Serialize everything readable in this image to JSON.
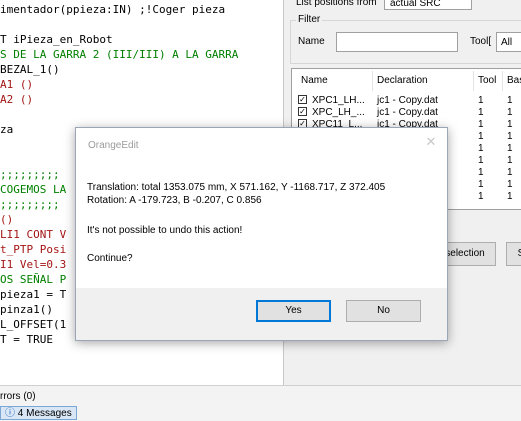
{
  "editor": {
    "lines": [
      {
        "text": "imentador(ppieza:IN) ;!Coger pieza",
        "tone": "blk"
      },
      {
        "text": "",
        "tone": "blk"
      },
      {
        "text": "T iPieza_en_Robot",
        "tone": "blk"
      },
      {
        "text": "S DE LA GARRA 2 (III/III) A LA GARRA",
        "tone": "grn"
      },
      {
        "text": "BEZAL_1()",
        "tone": "blk"
      },
      {
        "text": "A1 ()",
        "tone": "red"
      },
      {
        "text": "A2 ()",
        "tone": "red"
      },
      {
        "text": "",
        "tone": "blk"
      },
      {
        "text": "za",
        "tone": "blk"
      },
      {
        "text": "",
        "tone": "blk"
      },
      {
        "text": "",
        "tone": "blk"
      },
      {
        "text": ";;;;;;;;;",
        "tone": "grn"
      },
      {
        "text": "COGEMOS LA",
        "tone": "grn"
      },
      {
        "text": ";;;;;;;;;",
        "tone": "grn"
      },
      {
        "text": "()",
        "tone": "red"
      },
      {
        "text": "LI1 CONT V",
        "tone": "red"
      },
      {
        "text": "t_PTP Posi",
        "tone": "red"
      },
      {
        "text": "I1 Vel=0.3",
        "tone": "red"
      },
      {
        "text": "OS SEÑAL P",
        "tone": "grn"
      },
      {
        "text": "pieza1 = T",
        "tone": "blk"
      },
      {
        "text": "pinza1()",
        "tone": "blk"
      },
      {
        "text": "L_OFFSET(1",
        "tone": "blk"
      },
      {
        "text": "T = TRUE",
        "tone": "blk"
      }
    ]
  },
  "panel": {
    "top_label": "List positions from",
    "top_value": "actual SRC",
    "filter_label": "Filter",
    "name_label": "Name",
    "tool_label": "Tool[",
    "tool_value": "All",
    "columns": [
      "Name",
      "Declaration",
      "Tool",
      "Bas"
    ],
    "rows": [
      {
        "check": "✓",
        "name": "XPC1_LH...",
        "decl": "jc1 - Copy.dat",
        "tool": "1",
        "base": "1"
      },
      {
        "check": "✓",
        "name": "XPC_LH_...",
        "decl": "jc1 - Copy.dat",
        "tool": "1",
        "base": "1"
      },
      {
        "check": "✓",
        "name": "XPC11_L...",
        "decl": "jc1 - Copy.dat",
        "tool": "1",
        "base": "1"
      },
      {
        "check": "",
        "name": "",
        "decl": "",
        "tool": "1",
        "base": "1"
      },
      {
        "check": "",
        "name": "",
        "decl": "",
        "tool": "1",
        "base": "1"
      },
      {
        "check": "",
        "name": "",
        "decl": "",
        "tool": "1",
        "base": "1"
      },
      {
        "check": "",
        "name": "",
        "decl": "",
        "tool": "1",
        "base": "1"
      },
      {
        "check": "",
        "name": "",
        "decl": "",
        "tool": "1",
        "base": "1"
      },
      {
        "check": "",
        "name": "",
        "decl": "",
        "tool": "1",
        "base": "1"
      }
    ],
    "selection_btn": "selection",
    "s_btn": "S"
  },
  "dialog": {
    "title": "OrangeEdit",
    "close": "✕",
    "line1": "Translation: total 1353.075 mm, X 571.162, Y -1168.717, Z 372.405",
    "line2": "Rotation: A -179.723, B -0.207, C 0.856",
    "line3": "It's not possible to undo this action!",
    "line4": "Continue?",
    "yes": "Yes",
    "no": "No"
  },
  "bottom": {
    "errors_tab": "rrors (0)",
    "messages_tab": "4 Messages",
    "messages_icon": "ⓘ"
  }
}
